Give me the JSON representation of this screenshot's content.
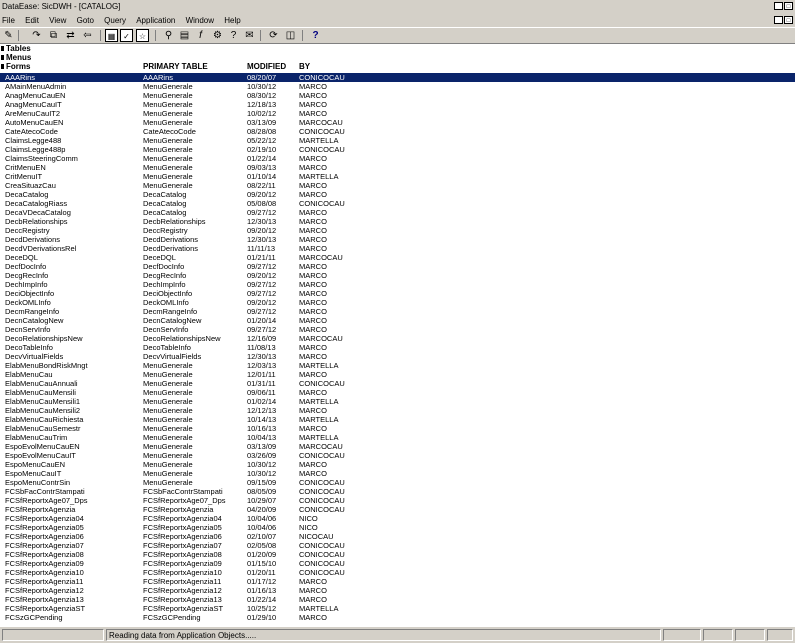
{
  "window": {
    "title": "DataEase: SicDWH - [CATALOG]"
  },
  "menu": [
    "File",
    "Edit",
    "View",
    "Goto",
    "Query",
    "Application",
    "Window",
    "Help"
  ],
  "toolbar_icons": [
    "design-pencil-icon",
    "open-icon",
    "copy-icon",
    "move-icon",
    "import-icon",
    "table-view-icon",
    "form-view-icon",
    "relation-icon",
    "query-icon",
    "library-icon",
    "function-icon",
    "procedure-icon",
    "help-page-icon",
    "document-icon",
    "refresh-icon",
    "report-icon",
    "context-help-icon"
  ],
  "tree": [
    "Tables",
    "Menus",
    "Forms"
  ],
  "columns": {
    "name": "",
    "primary": "PRIMARY TABLE",
    "modified": "MODIFIED",
    "by": "BY"
  },
  "rows": [
    [
      "AAARins",
      "AAARins",
      "08/20/07",
      "CONICOCAU"
    ],
    [
      "AMainMenuAdmin",
      "MenuGenerale",
      "10/30/12",
      "MARCO"
    ],
    [
      "AnagMenuCauEN",
      "MenuGenerale",
      "08/30/12",
      "MARCO"
    ],
    [
      "AnagMenuCauIT",
      "MenuGenerale",
      "12/18/13",
      "MARCO"
    ],
    [
      "AreMenuCauIT2",
      "MenuGenerale",
      "10/02/12",
      "MARCO"
    ],
    [
      "AutoMenuCauEN",
      "MenuGenerale",
      "03/13/09",
      "MARCOCAU"
    ],
    [
      "CateAtecoCode",
      "CateAtecoCode",
      "08/28/08",
      "CONICOCAU"
    ],
    [
      "ClaimsLegge488",
      "MenuGenerale",
      "05/22/12",
      "MARTELLA"
    ],
    [
      "ClaimsLegge488p",
      "MenuGenerale",
      "02/19/10",
      "CONICOCAU"
    ],
    [
      "ClaimsSteeringComm",
      "MenuGenerale",
      "01/22/14",
      "MARCO"
    ],
    [
      "CritMenuEN",
      "MenuGenerale",
      "09/03/13",
      "MARCO"
    ],
    [
      "CritMenuIT",
      "MenuGenerale",
      "01/10/14",
      "MARTELLA"
    ],
    [
      "CreaSituazCau",
      "MenuGenerale",
      "08/22/11",
      "MARCO"
    ],
    [
      "DecaCatalog",
      "DecaCatalog",
      "09/20/12",
      "MARCO"
    ],
    [
      "DecaCatalogRiass",
      "DecaCatalog",
      "05/08/08",
      "CONICOCAU"
    ],
    [
      "DecaVDecaCatalog",
      "DecaCatalog",
      "09/27/12",
      "MARCO"
    ],
    [
      "DecbRelationships",
      "DecbRelationships",
      "12/30/13",
      "MARCO"
    ],
    [
      "DeccRegistry",
      "DeccRegistry",
      "09/20/12",
      "MARCO"
    ],
    [
      "DecdDerivations",
      "DecdDerivations",
      "12/30/13",
      "MARCO"
    ],
    [
      "DecdVDerivationsRel",
      "DecdDerivations",
      "11/11/13",
      "MARCO"
    ],
    [
      "DeceDQL",
      "DeceDQL",
      "01/21/11",
      "MARCOCAU"
    ],
    [
      "DecfDocInfo",
      "DecfDocInfo",
      "09/27/12",
      "MARCO"
    ],
    [
      "DecgRecInfo",
      "DecgRecInfo",
      "09/20/12",
      "MARCO"
    ],
    [
      "DechImpInfo",
      "DechImpInfo",
      "09/27/12",
      "MARCO"
    ],
    [
      "DeciObjectInfo",
      "DeciObjectInfo",
      "09/27/12",
      "MARCO"
    ],
    [
      "DeckOMLInfo",
      "DeckOMLInfo",
      "09/20/12",
      "MARCO"
    ],
    [
      "DecmRangeInfo",
      "DecmRangeInfo",
      "09/27/12",
      "MARCO"
    ],
    [
      "DecnCatalogNew",
      "DecnCatalogNew",
      "01/20/14",
      "MARCO"
    ],
    [
      "DecnServInfo",
      "DecnServInfo",
      "09/27/12",
      "MARCO"
    ],
    [
      "DecoRelationshipsNew",
      "DecoRelationshipsNew",
      "12/16/09",
      "MARCOCAU"
    ],
    [
      "DecoTableInfo",
      "DecoTableInfo",
      "11/08/13",
      "MARCO"
    ],
    [
      "DecvVirtualFields",
      "DecvVirtualFields",
      "12/30/13",
      "MARCO"
    ],
    [
      "ElabMenuBondRiskMngt",
      "MenuGenerale",
      "12/03/13",
      "MARTELLA"
    ],
    [
      "ElabMenuCau",
      "MenuGenerale",
      "12/01/11",
      "MARCO"
    ],
    [
      "ElabMenuCauAnnuali",
      "MenuGenerale",
      "01/31/11",
      "CONICOCAU"
    ],
    [
      "ElabMenuCauMensili",
      "MenuGenerale",
      "09/06/11",
      "MARCO"
    ],
    [
      "ElabMenuCauMensili1",
      "MenuGenerale",
      "01/02/14",
      "MARTELLA"
    ],
    [
      "ElabMenuCauMensili2",
      "MenuGenerale",
      "12/12/13",
      "MARCO"
    ],
    [
      "ElabMenuCauRichiesta",
      "MenuGenerale",
      "10/14/13",
      "MARTELLA"
    ],
    [
      "ElabMenuCauSemestr",
      "MenuGenerale",
      "10/16/13",
      "MARCO"
    ],
    [
      "ElabMenuCauTrim",
      "MenuGenerale",
      "10/04/13",
      "MARTELLA"
    ],
    [
      "EspoEvolMenuCauEN",
      "MenuGenerale",
      "03/13/09",
      "MARCOCAU"
    ],
    [
      "EspoEvolMenuCauIT",
      "MenuGenerale",
      "03/26/09",
      "CONICOCAU"
    ],
    [
      "EspoMenuCauEN",
      "MenuGenerale",
      "10/30/12",
      "MARCO"
    ],
    [
      "EspoMenuCauIT",
      "MenuGenerale",
      "10/30/12",
      "MARCO"
    ],
    [
      "EspoMenuContrSin",
      "MenuGenerale",
      "09/15/09",
      "CONICOCAU"
    ],
    [
      "FCSbFacContrStampati",
      "FCSbFacContrStampati",
      "08/05/09",
      "CONICOCAU"
    ],
    [
      "FCSfReportxAge07_Dps",
      "FCSfReportxAge07_Dps",
      "10/29/07",
      "CONICOCAU"
    ],
    [
      "FCSfReportxAgenzia",
      "FCSfReportxAgenzia",
      "04/20/09",
      "CONICOCAU"
    ],
    [
      "FCSfReportxAgenzia04",
      "FCSfReportxAgenzia04",
      "10/04/06",
      "NICO"
    ],
    [
      "FCSfReportxAgenzia05",
      "FCSfReportxAgenzia05",
      "10/04/06",
      "NICO"
    ],
    [
      "FCSfReportxAgenzia06",
      "FCSfReportxAgenzia06",
      "02/10/07",
      "NICOCAU"
    ],
    [
      "FCSfReportxAgenzia07",
      "FCSfReportxAgenzia07",
      "02/05/08",
      "CONICOCAU"
    ],
    [
      "FCSfReportxAgenzia08",
      "FCSfReportxAgenzia08",
      "01/20/09",
      "CONICOCAU"
    ],
    [
      "FCSfReportxAgenzia09",
      "FCSfReportxAgenzia09",
      "01/15/10",
      "CONICOCAU"
    ],
    [
      "FCSfReportxAgenzia10",
      "FCSfReportxAgenzia10",
      "01/20/11",
      "CONICOCAU"
    ],
    [
      "FCSfReportxAgenzia11",
      "FCSfReportxAgenzia11",
      "01/17/12",
      "MARCO"
    ],
    [
      "FCSfReportxAgenzia12",
      "FCSfReportxAgenzia12",
      "01/16/13",
      "MARCO"
    ],
    [
      "FCSfReportxAgenzia13",
      "FCSfReportxAgenzia13",
      "01/22/14",
      "MARCO"
    ],
    [
      "FCSfReportxAgenziaST",
      "FCSfReportxAgenziaST",
      "10/25/12",
      "MARTELLA"
    ],
    [
      "FCSzGCPending",
      "FCSzGCPending",
      "01/29/10",
      "MARCO"
    ]
  ],
  "status": {
    "message": "Reading data from Application Objects....."
  }
}
